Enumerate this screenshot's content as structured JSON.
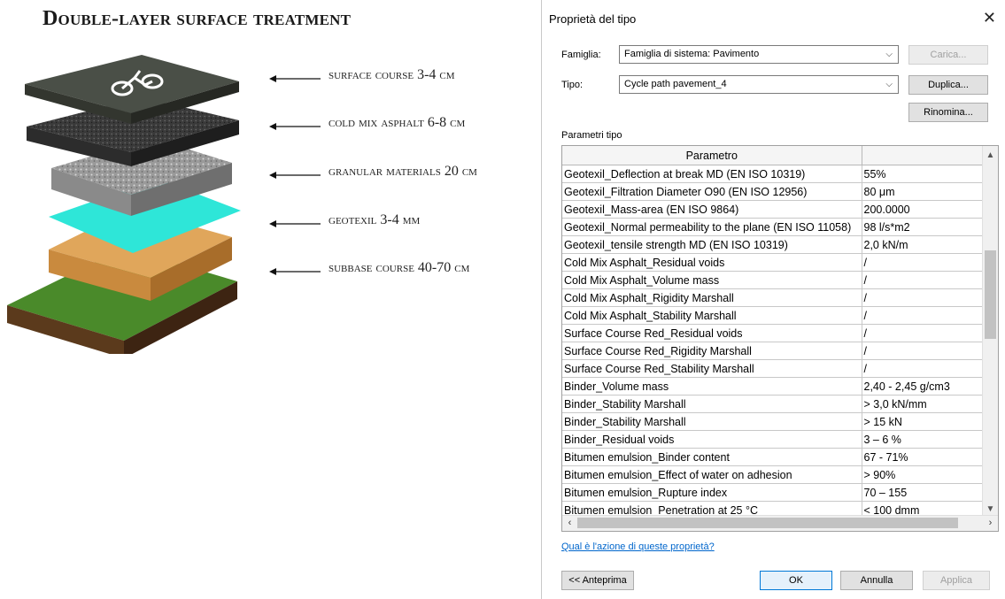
{
  "illustration": {
    "title": "Double-layer surface treatment",
    "layers": [
      "surface course 3-4 cm",
      "cold mix asphalt 6-8 cm",
      "granular materials 20 cm",
      "geotexil 3-4 mm",
      "subbase course 40-70 cm"
    ]
  },
  "dialog": {
    "title": "Proprietà del tipo",
    "close_glyph": "✕",
    "family_label": "Famiglia:",
    "family_value": "Famiglia di sistema: Pavimento",
    "type_label": "Tipo:",
    "type_value": "Cycle path pavement_4",
    "load_button": "Carica...",
    "duplicate_button": "Duplica...",
    "rename_button": "Rinomina...",
    "section_label": "Parametri tipo",
    "grid": {
      "header_param": "Parametro",
      "header_value": "",
      "rows": [
        [
          "Geotexil_Deflection at break MD (EN ISO 10319)",
          "55%"
        ],
        [
          "Geotexil_Filtration Diameter O90 (EN ISO 12956)",
          "80 μm"
        ],
        [
          "Geotexil_Mass-area (EN ISO 9864)",
          "200.0000"
        ],
        [
          "Geotexil_Normal permeability to the plane (EN ISO 11058)",
          "98 l/s*m2"
        ],
        [
          "Geotexil_tensile strength MD (EN ISO 10319)",
          "2,0 kN/m"
        ],
        [
          "Cold Mix Asphalt_Residual voids",
          "/"
        ],
        [
          "Cold Mix Asphalt_Volume mass",
          "/"
        ],
        [
          "Cold Mix Asphalt_Rigidity Marshall",
          "/"
        ],
        [
          "Cold Mix Asphalt_Stability Marshall",
          "/"
        ],
        [
          "Surface Course Red_Residual voids",
          "/"
        ],
        [
          "Surface Course Red_Rigidity Marshall",
          "/"
        ],
        [
          "Surface Course Red_Stability Marshall",
          "/"
        ],
        [
          "Binder_Volume mass",
          "2,40 - 2,45 g/cm3"
        ],
        [
          "Binder_Stability Marshall",
          "> 3,0 kN/mm"
        ],
        [
          "Binder_Stability Marshall",
          "> 15 kN"
        ],
        [
          "Binder_Residual voids",
          "3 – 6 %"
        ],
        [
          "Bitumen emulsion_Binder content",
          "67 - 71%"
        ],
        [
          "Bitumen emulsion_Effect of water on adhesion",
          "> 90%"
        ],
        [
          "Bitumen emulsion_Rupture index",
          "70 – 155"
        ],
        [
          "Bitumen emulsion_Penetration at 25 °C",
          "< 100 dmm"
        ]
      ]
    },
    "help_link": "Qual è l'azione di queste proprietà?",
    "preview_button": "<< Anteprima",
    "ok_button": "OK",
    "cancel_button": "Annulla",
    "apply_button": "Applica",
    "colors": {
      "link": "#0066cc",
      "geotexil": "#2ee6d8"
    }
  }
}
